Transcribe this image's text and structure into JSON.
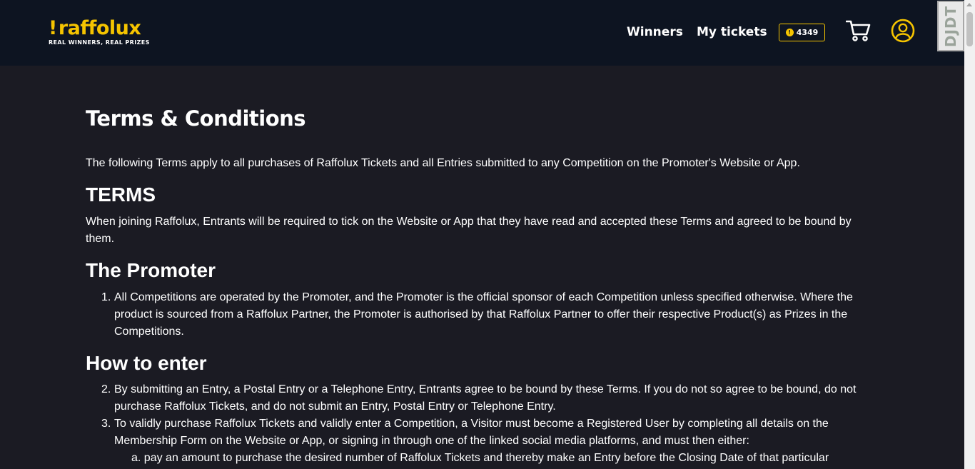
{
  "header": {
    "logo_word": "raffolux",
    "logo_bang": "!",
    "logo_tagline": "REAL WINNERS, REAL PRIZES",
    "nav": {
      "winners": "Winners",
      "my_tickets": "My tickets"
    },
    "coins": {
      "value": "4349",
      "icon_glyph": "!"
    },
    "icons": [
      "cart-icon",
      "user-icon"
    ]
  },
  "debug_toolbar": {
    "label": "DJDT"
  },
  "page": {
    "title": "Terms & Conditions",
    "intro": "The following Terms apply to all purchases of Raffolux Tickets and all Entries submitted to any Competition on the Promoter's Website or App.",
    "sections": [
      {
        "heading": "TERMS",
        "paragraph_line1": "When joining Raffolux, Entrants will be required to tick on the Website or App that they have read and accepted these Terms and agreed to be bound by",
        "paragraph_line2": "them."
      },
      {
        "heading": "The Promoter",
        "items": [
          {
            "num": "1.",
            "line1": "All Competitions are operated by the Promoter, and the Promoter is the official sponsor of each Competition unless specified otherwise. Where the",
            "line2": "product is sourced from a Raffolux Partner, the Promoter is authorised by that Raffolux Partner to offer their respective Product(s) as Prizes in the",
            "line3": "Competitions."
          }
        ]
      },
      {
        "heading": "How to enter",
        "items": [
          {
            "num": "2.",
            "line1": "By submitting an Entry, a Postal Entry or a Telephone Entry, Entrants agree to be bound by these Terms. If you do not so agree to be bound, do not",
            "line2": "purchase Raffolux Tickets, and do not submit an Entry, Postal Entry or Telephone Entry."
          },
          {
            "num": "3.",
            "line1": "To validly purchase Raffolux Tickets and validly enter a Competition, a Visitor must become a Registered User by completing all details on the",
            "line2": "Membership Form on the Website or App, or signing in through one of the linked social media platforms, and must then either:"
          }
        ],
        "subitems": [
          {
            "label": "a.",
            "text": "pay an amount to purchase the desired number of Raffolux Tickets and thereby make an Entry before the Closing Date of that particular"
          }
        ]
      }
    ]
  },
  "colors": {
    "background": "#1b1b23",
    "header_bg": "#0d1421",
    "accent": "#f5c400",
    "text": "#ffffff"
  }
}
